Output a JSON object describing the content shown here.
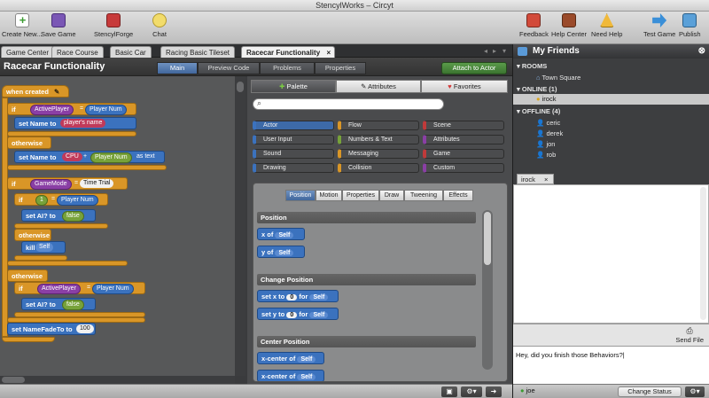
{
  "window": {
    "title": "StencylWorks – Circyt"
  },
  "toolbar": {
    "left": [
      {
        "label": "Create New...",
        "icon": "create-new-icon"
      },
      {
        "label": "Save Game",
        "icon": "save-icon"
      },
      {
        "label": "StencylForge",
        "icon": "stencylforge-icon"
      },
      {
        "label": "Chat",
        "icon": "chat-icon"
      }
    ],
    "right": [
      {
        "label": "Feedback",
        "icon": "megaphone-icon"
      },
      {
        "label": "Help Center",
        "icon": "book-icon"
      },
      {
        "label": "Need Help",
        "icon": "warning-icon"
      },
      {
        "label": "Test Game",
        "icon": "arrow-right-icon"
      },
      {
        "label": "Publish",
        "icon": "publish-icon"
      }
    ]
  },
  "tabs": [
    "Game Center",
    "Race Course",
    "Basic Car",
    "Racing Basic Tileset",
    "Racecar Functionality"
  ],
  "tab_close": "×",
  "editor": {
    "title": "Racecar Functionality",
    "modes": [
      "Main",
      "Preview Code",
      "Problems",
      "Properties"
    ],
    "attach": "Attach to Actor"
  },
  "blocks": {
    "when_created": "when created",
    "if1": "if",
    "activeplayer": "ActivePlayer",
    "eq": "=",
    "playernum": "Player Num",
    "set_name_to": "set Name to",
    "players_name": "player's name",
    "otherwise": "otherwise",
    "set_name_to2": "set Name to",
    "cpu": "CPU",
    "plus": "+",
    "playernum2": "Player Num",
    "as_text": "as text",
    "if2": "if",
    "gamemode": "GameMode",
    "eq2": "=",
    "time_trial": "Time Trial",
    "if3": "if",
    "one": "1",
    "eq3": "=",
    "playernum3": "Player Num",
    "set_ai": "set AI? to",
    "false1": "false",
    "otherwise2": "otherwise",
    "kill": "kill",
    "self1": "Self",
    "otherwise3": "otherwise",
    "if4": "if",
    "activeplayer2": "ActivePlayer",
    "eq4": "=",
    "playernum4": "Player Num",
    "set_ai2": "set AI? to",
    "false2": "false",
    "set_namefade": "set NameFadeTo to",
    "hundred": "100"
  },
  "palette": {
    "tabs": [
      "Palette",
      "Attributes",
      "Favorites"
    ],
    "search_placeholder": "",
    "categories": [
      "Actor",
      "Flow",
      "Scene",
      "User Input",
      "Numbers & Text",
      "Attributes",
      "Sound",
      "Messaging",
      "Game",
      "Drawing",
      "Collision",
      "Custom"
    ],
    "subtabs": [
      "Position",
      "Motion",
      "Properties",
      "Draw",
      "Tweening",
      "Effects"
    ],
    "sections": [
      "Position",
      "Change Position",
      "Center Position"
    ],
    "x_of": "x of",
    "y_of": "y of",
    "self": "Self",
    "set_x_to": "set x to",
    "set_y_to": "set y to",
    "zero": "0",
    "for": "for",
    "xcenter_of": "x-center of"
  },
  "friends": {
    "title": "My Friends",
    "rooms_label": "ROOMS",
    "room": "Town Square",
    "online_label": "ONLINE (1)",
    "online": [
      "irock"
    ],
    "offline_label": "OFFLINE (4)",
    "offline": [
      "ceric",
      "derek",
      "jon",
      "rob"
    ],
    "chat_tab": "irock",
    "send_file": "Send File",
    "message": "Hey, did you finish those Behaviors?",
    "user": "joe",
    "change_status": "Change Status"
  }
}
